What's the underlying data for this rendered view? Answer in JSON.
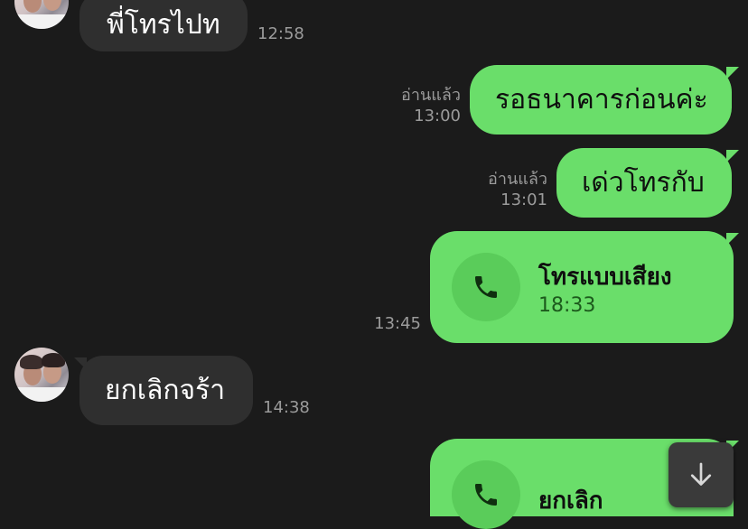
{
  "messages": [
    {
      "text": "พี่โทรไปท",
      "time": "12:58"
    },
    {
      "text": "รอธนาคารก่อนค่ะ",
      "read": "อ่านแล้ว",
      "time": "13:00"
    },
    {
      "text": "เด่วโทรกับ",
      "read": "อ่านแล้ว",
      "time": "13:01"
    },
    {
      "title": "โทรแบบเสียง",
      "duration": "18:33",
      "time": "13:45"
    },
    {
      "text": "ยกเลิกจร้า",
      "time": "14:38"
    },
    {
      "title": "ยกเลิก"
    }
  ],
  "icons": {
    "call": "phone-icon",
    "scroll": "arrow-down-icon"
  },
  "colors": {
    "background": "#1b1b1b",
    "incoming": "#2f2f2f",
    "outgoing": "#6ade6a",
    "meta": "#9b9b9b"
  }
}
